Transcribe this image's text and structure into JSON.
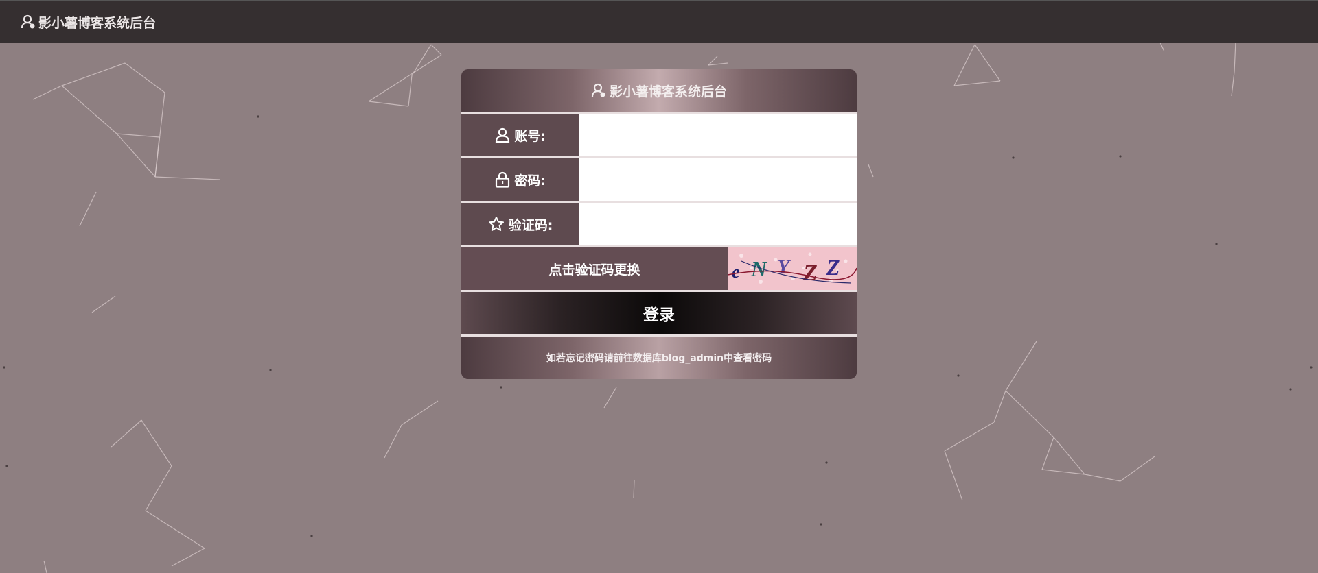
{
  "app": {
    "title": "影小薯博客系统后台",
    "icons": {
      "brand": "user-icon"
    }
  },
  "login": {
    "header_title": "影小薯博客系统后台",
    "fields": [
      {
        "label": "账号:",
        "icon": "user-icon",
        "value": ""
      },
      {
        "label": "密码:",
        "icon": "lock-icon",
        "value": ""
      },
      {
        "label": "验证码:",
        "icon": "star-icon",
        "value": ""
      }
    ],
    "captcha": {
      "hint": "点击验证码更换",
      "code": "eNYZZ"
    },
    "submit_label": "登录",
    "footer_note": "如若忘记密码请前往数据库blog_admin中查看密码"
  },
  "colors": {
    "background": "#8e7f81",
    "topbar": "#352f30",
    "panel_label": "#5e4a4f",
    "captcha_bg": "#f2c4cc"
  }
}
